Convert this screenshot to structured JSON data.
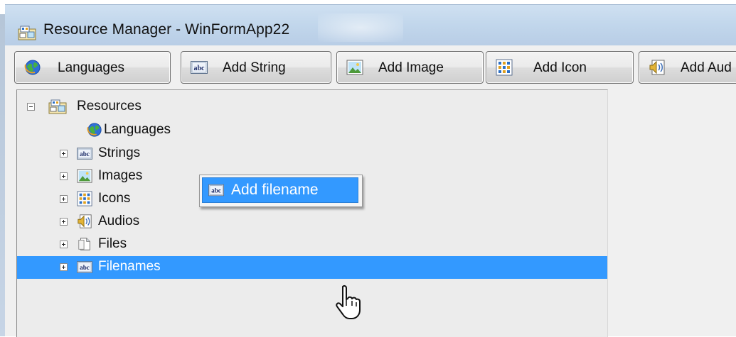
{
  "window": {
    "title": "Resource Manager - WinFormApp22",
    "title_icon": "resource-manager-icon"
  },
  "toolbar": {
    "buttons": [
      {
        "label": "Languages",
        "icon": "globe-icon"
      },
      {
        "label": "Add String",
        "icon": "abc-string-icon"
      },
      {
        "label": "Add Image",
        "icon": "image-icon"
      },
      {
        "label": "Add Icon",
        "icon": "icon-grid-icon"
      },
      {
        "label": "Add Aud",
        "icon": "audio-icon"
      }
    ]
  },
  "tree": {
    "root": {
      "label": "Resources",
      "expanded": true
    },
    "items": [
      {
        "label": "Languages",
        "icon": "globe-icon",
        "expandable": false
      },
      {
        "label": "Strings",
        "icon": "abc-string-icon",
        "expandable": true
      },
      {
        "label": "Images",
        "icon": "image-icon",
        "expandable": true
      },
      {
        "label": "Icons",
        "icon": "icon-grid-icon",
        "expandable": true
      },
      {
        "label": "Audios",
        "icon": "audio-icon",
        "expandable": true
      },
      {
        "label": "Files",
        "icon": "file-icon",
        "expandable": true
      },
      {
        "label": "Filenames",
        "icon": "abc-string-icon",
        "expandable": true,
        "selected": true
      }
    ]
  },
  "context_menu": {
    "items": [
      {
        "label": "Add filename",
        "icon": "abc-string-icon",
        "highlighted": true
      }
    ]
  },
  "colors": {
    "selection": "#3399ff",
    "titlebar": "#c2d7ec",
    "panel": "#ececec"
  }
}
